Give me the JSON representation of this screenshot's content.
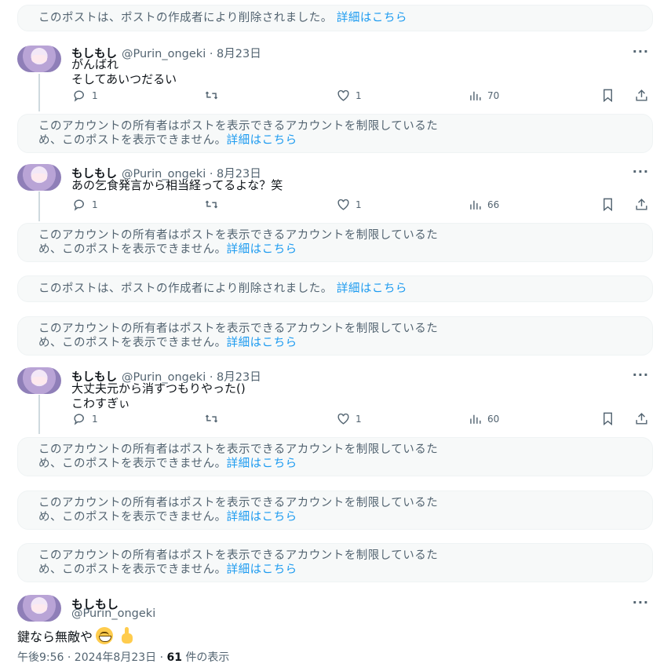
{
  "notices": {
    "deleted": {
      "text": "このポストは、ポストの作成者により削除されました。",
      "link": "詳細はこちら"
    },
    "restricted": {
      "line1": "このアカウントの所有者はポストを表示できるアカウントを制限しているた",
      "line2": "め、このポストを表示できません。",
      "link": "詳細はこちら"
    }
  },
  "tweets": [
    {
      "name": "もしもし",
      "handle": "@Purin_ongeki · 8月23日",
      "lines": [
        "がんばれ",
        "そしてあいつだるい"
      ],
      "replies": "1",
      "likes": "1",
      "views": "70"
    },
    {
      "name": "もしもし",
      "handle": "@Purin_ongeki · 8月23日",
      "lines": [
        "あの乞食発言から相当経ってるよな？笑"
      ],
      "replies": "1",
      "likes": "1",
      "views": "66"
    },
    {
      "name": "もしもし",
      "handle": "@Purin_ongeki · 8月23日",
      "lines": [
        "大丈夫元から消すつもりやった()",
        "こわすぎぃ"
      ],
      "replies": "1",
      "likes": "1",
      "views": "60"
    }
  ],
  "final": {
    "name": "もしもし",
    "handle": "@Purin_ongeki",
    "text": "鍵なら無敵や",
    "timestamp": "午後9:56 · 2024年8月23日 · ",
    "view_count": "61",
    "view_suffix": " 件の表示"
  },
  "more_label": "···",
  "colors": {
    "link": "#1d9bf0",
    "muted": "#536471",
    "notice_bg": "#f7f9f9"
  }
}
